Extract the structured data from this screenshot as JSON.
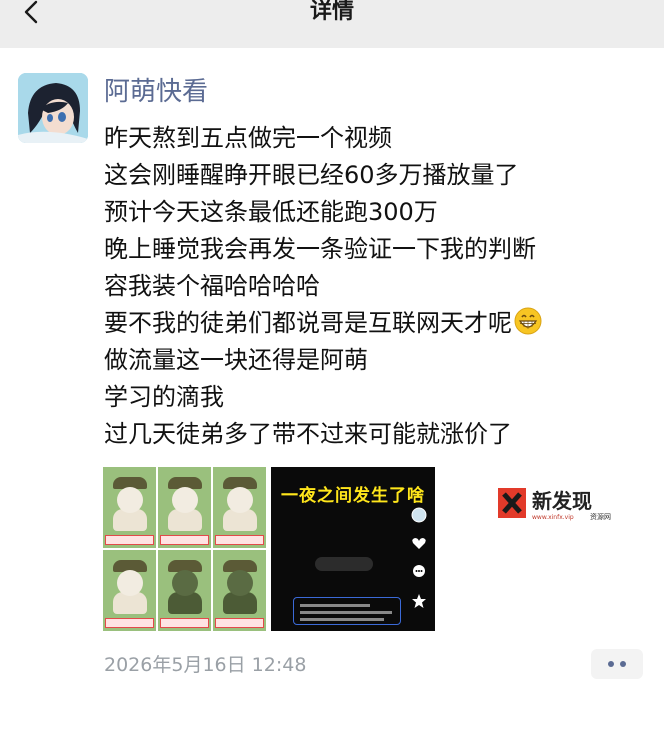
{
  "header": {
    "title": "详情",
    "back_icon": "chevron-left-icon"
  },
  "post": {
    "author": "阿萌快看",
    "lines": [
      "昨天熬到五点做完一个视频",
      "这会刚睡醒睁开眼已经60多万播放量了",
      "预计今天这条最低还能跑300万",
      "晚上睡觉我会再发一条验证一下我的判断",
      "容我装个福哈哈哈哈",
      "要不我的徒弟们都说哥是互联网天才呢",
      "做流量这一块还得是阿萌",
      "学习的滴我",
      "过几天徒弟多了带不过来可能就涨价了"
    ],
    "emoji": "grin-emoji",
    "images": [
      {
        "name": "cat-meme-collage"
      },
      {
        "name": "video-screenshot",
        "overlay_title": "一夜之间发生了啥"
      }
    ],
    "timestamp": "2026年5月16日 12:48"
  },
  "watermark": {
    "brand": "新发现",
    "url": "www.xinfx.vip",
    "sub": "资源网"
  },
  "colors": {
    "link": "#5b6b93",
    "topbar": "#ededed",
    "meta": "#9aa0a6",
    "accent_yellow": "#ffe61b"
  }
}
